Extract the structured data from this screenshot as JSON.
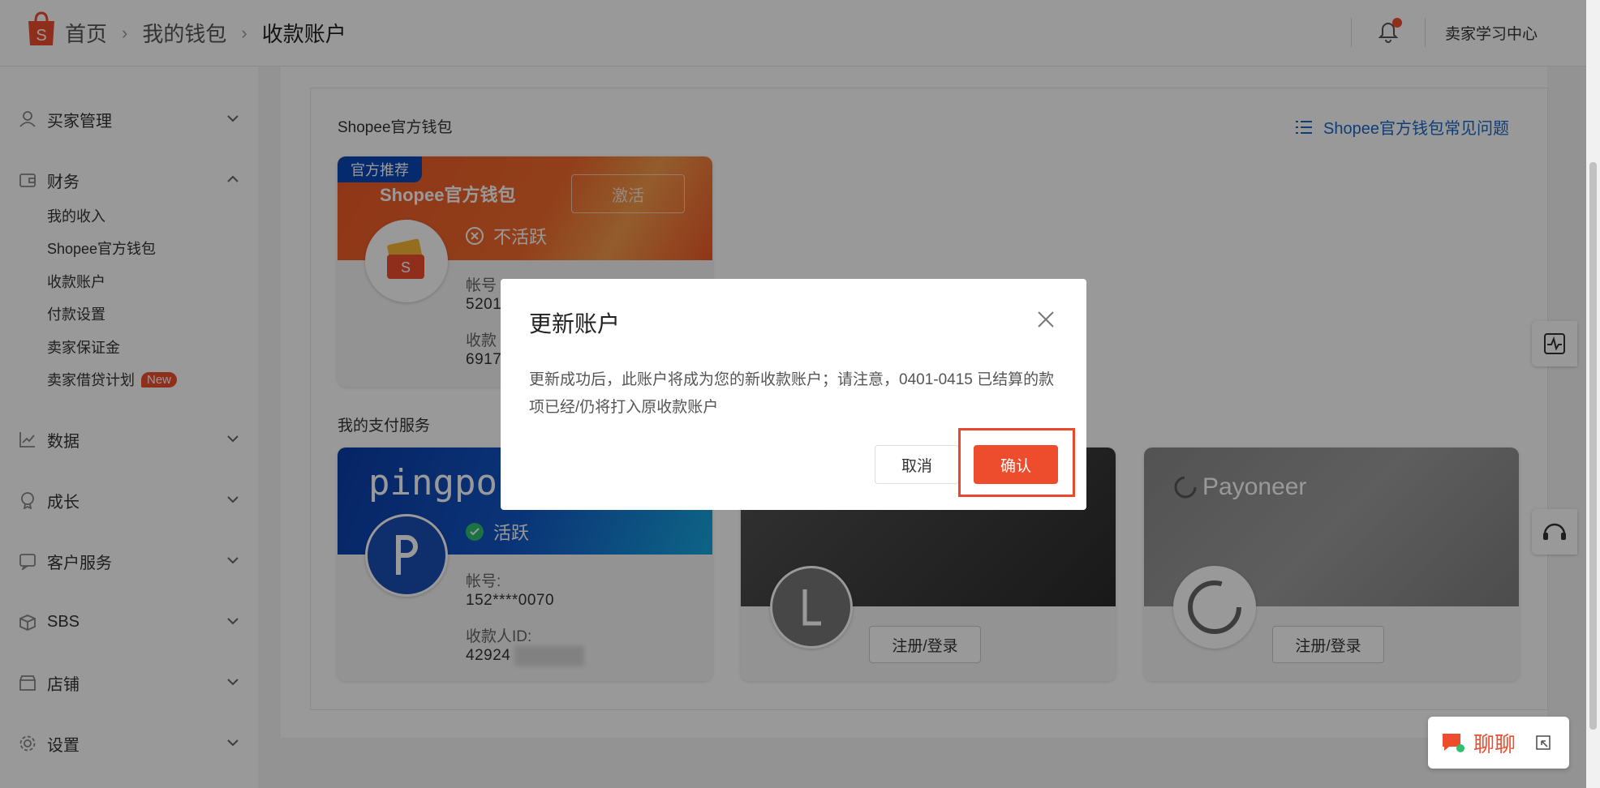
{
  "header": {
    "breadcrumb": [
      "首页",
      "我的钱包",
      "收款账户"
    ],
    "learning_center": "卖家学习中心"
  },
  "sidebar": {
    "groups": [
      {
        "label": "买家管理",
        "icon": "buyer-icon",
        "expanded": false
      },
      {
        "label": "财务",
        "icon": "wallet-icon",
        "expanded": true
      },
      {
        "label": "数据",
        "icon": "chart-icon",
        "expanded": false
      },
      {
        "label": "成长",
        "icon": "growth-icon",
        "expanded": false
      },
      {
        "label": "客户服务",
        "icon": "service-icon",
        "expanded": false
      },
      {
        "label": "SBS",
        "icon": "box-icon",
        "expanded": false
      },
      {
        "label": "店铺",
        "icon": "shop-icon",
        "expanded": false
      },
      {
        "label": "设置",
        "icon": "gear-icon",
        "expanded": false
      }
    ],
    "finance_items": [
      "我的收入",
      "Shopee官方钱包",
      "收款账户",
      "付款设置",
      "卖家保证金",
      "卖家借贷计划"
    ],
    "new_badge": "New"
  },
  "main": {
    "wallet_section_title": "Shopee官方钱包",
    "faq_link": "Shopee官方钱包常见问题",
    "payment_section_title": "我的支付服务",
    "shopee_card": {
      "tag": "官方推荐",
      "name": "Shopee官方钱包",
      "activate": "激活",
      "status": "不活跃",
      "account_label": "帐号",
      "account_value": "5201",
      "payee_label": "收款",
      "payee_value": "6917"
    },
    "pingpong_card": {
      "brand": "pingpong",
      "status": "活跃",
      "account_label": "帐号:",
      "account_value": "152****0070",
      "payee_label": "收款人ID:",
      "payee_value": "42924"
    },
    "lianlian_card": {
      "avatar_letter": "L",
      "register": "注册/登录"
    },
    "payoneer_card": {
      "brand": "Payoneer",
      "register": "注册/登录"
    }
  },
  "modal": {
    "title": "更新账户",
    "body": "更新成功后，此账户将成为您的新收款账户；请注意，0401-0415 已结算的款项已经/仍将打入原收款账户",
    "cancel": "取消",
    "confirm": "确认"
  },
  "chat": {
    "label": "聊聊"
  },
  "colors": {
    "brand": "#ee4d2d",
    "link": "#1a67c9",
    "tag": "#0a46b8"
  }
}
